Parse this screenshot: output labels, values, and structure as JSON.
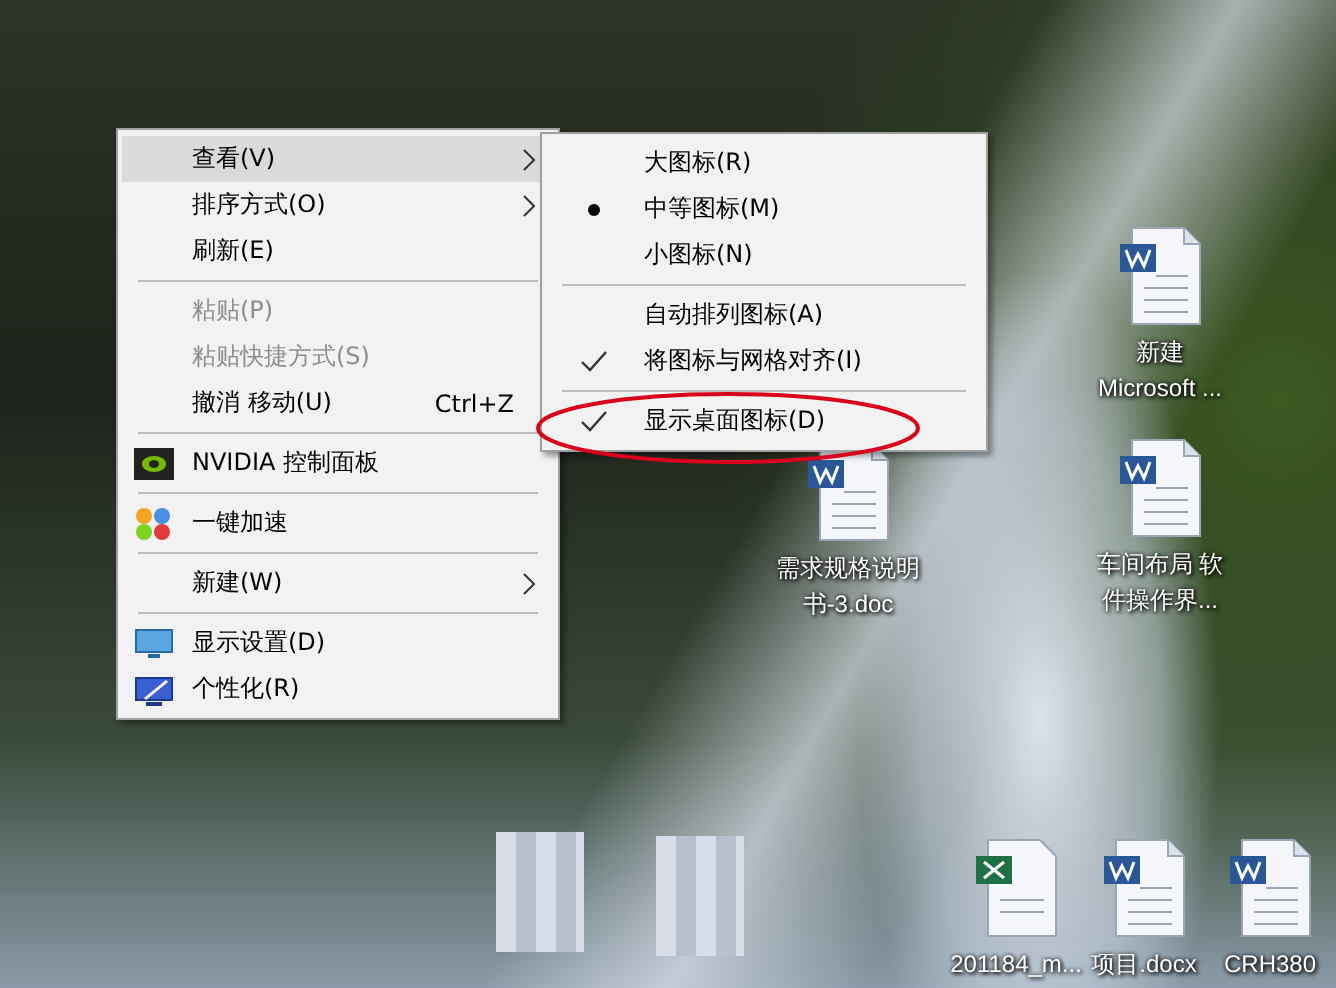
{
  "context_menu": {
    "items": [
      {
        "kind": "item",
        "label": "查看(V)",
        "submenu": true,
        "selected": true,
        "disabled": false
      },
      {
        "kind": "item",
        "label": "排序方式(O)",
        "submenu": true,
        "selected": false,
        "disabled": false
      },
      {
        "kind": "item",
        "label": "刷新(E)",
        "submenu": false,
        "selected": false,
        "disabled": false
      },
      {
        "kind": "separator"
      },
      {
        "kind": "item",
        "label": "粘贴(P)",
        "submenu": false,
        "selected": false,
        "disabled": true
      },
      {
        "kind": "item",
        "label": "粘贴快捷方式(S)",
        "submenu": false,
        "selected": false,
        "disabled": true
      },
      {
        "kind": "item",
        "label": "撤消 移动(U)",
        "shortcut": "Ctrl+Z",
        "submenu": false,
        "selected": false,
        "disabled": false
      },
      {
        "kind": "separator"
      },
      {
        "kind": "item",
        "label": "NVIDIA 控制面板",
        "submenu": false,
        "selected": false,
        "disabled": false
      },
      {
        "kind": "separator"
      },
      {
        "kind": "item",
        "label": "一键加速",
        "submenu": false,
        "selected": false,
        "disabled": false
      },
      {
        "kind": "separator"
      },
      {
        "kind": "item",
        "label": "新建(W)",
        "submenu": true,
        "selected": false,
        "disabled": false
      },
      {
        "kind": "separator"
      },
      {
        "kind": "item",
        "label": "显示设置(D)",
        "submenu": false,
        "selected": false,
        "disabled": false
      },
      {
        "kind": "item",
        "label": "个性化(R)",
        "submenu": false,
        "selected": false,
        "disabled": false
      }
    ]
  },
  "view_submenu": {
    "items": [
      {
        "kind": "radio",
        "label": "大图标(R)",
        "selected": false
      },
      {
        "kind": "radio",
        "label": "中等图标(M)",
        "selected": true
      },
      {
        "kind": "radio",
        "label": "小图标(N)",
        "selected": false
      },
      {
        "kind": "separator"
      },
      {
        "kind": "check",
        "label": "自动排列图标(A)",
        "checked": false
      },
      {
        "kind": "check",
        "label": "将图标与网格对齐(I)",
        "checked": true
      },
      {
        "kind": "separator"
      },
      {
        "kind": "check",
        "label": "显示桌面图标(D)",
        "checked": true
      }
    ]
  },
  "desktop_icons": [
    {
      "kind": "word",
      "label": [
        "新建",
        "Microsoft ..."
      ]
    },
    {
      "kind": "word",
      "label": [
        "需求规格说明",
        "书-3.doc"
      ]
    },
    {
      "kind": "word",
      "label": [
        "车间布局 软",
        "件操作界..."
      ]
    },
    {
      "kind": "blurred"
    },
    {
      "kind": "blurred"
    },
    {
      "kind": "excel",
      "label": [
        "201184_m..."
      ]
    },
    {
      "kind": "word",
      "label": [
        "项目.docx"
      ]
    },
    {
      "kind": "word",
      "label": [
        "CRH380"
      ]
    }
  ]
}
